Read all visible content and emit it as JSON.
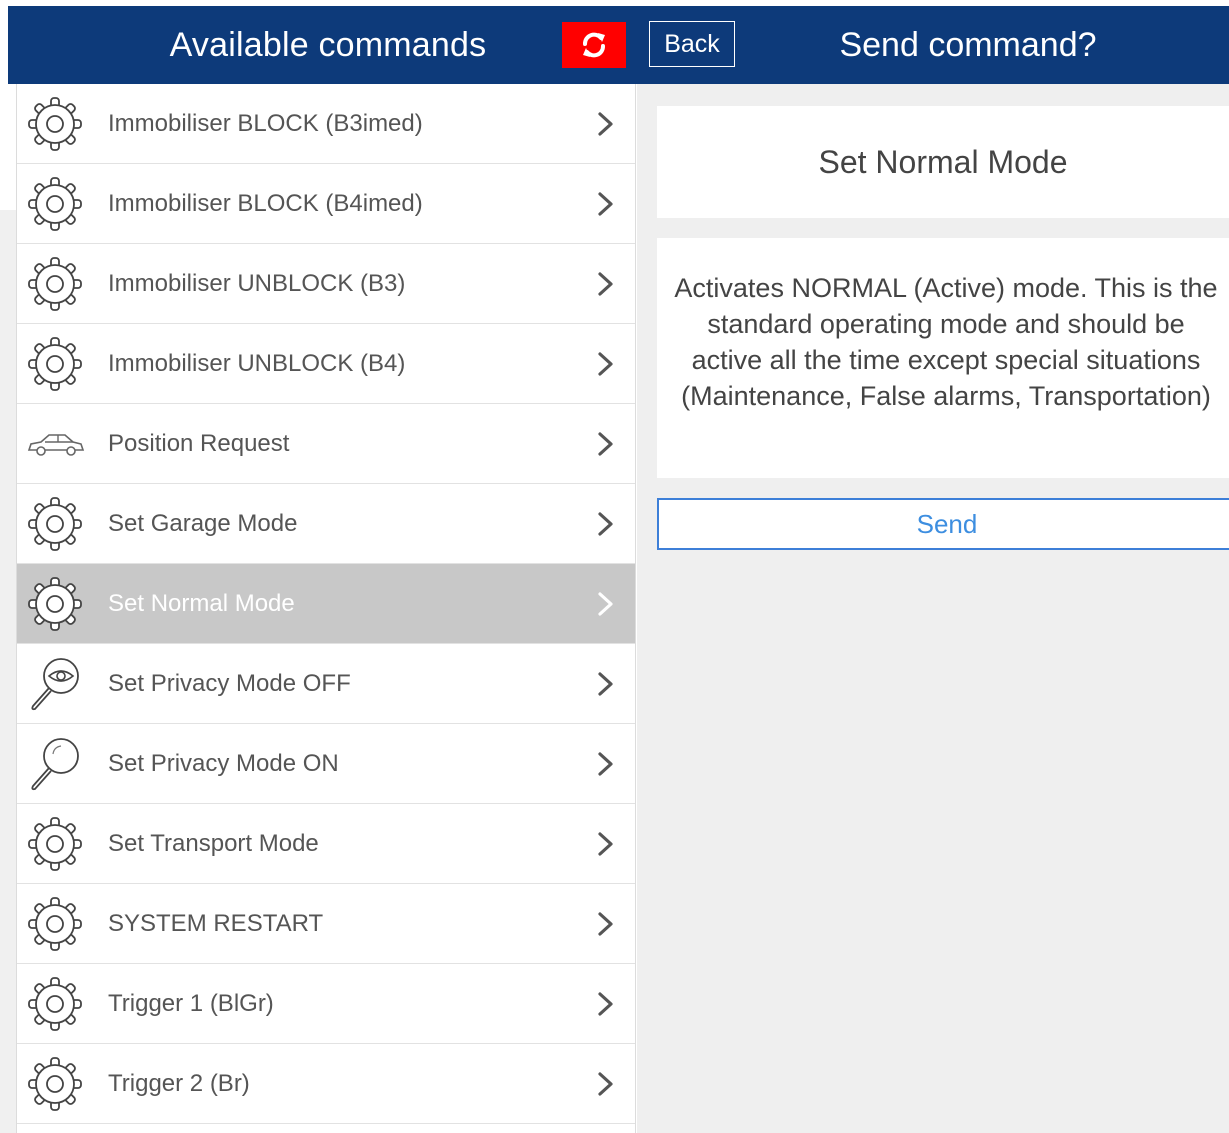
{
  "header": {
    "title_left": "Available commands",
    "back_label": "Back",
    "title_right": "Send command?",
    "refresh_icon": "refresh-icon",
    "colors": {
      "bar": "#0d3a7a",
      "refresh_bg": "#ff0000"
    }
  },
  "commands": [
    {
      "label": "Immobiliser BLOCK (B3imed)",
      "icon": "gear-icon",
      "selected": false
    },
    {
      "label": "Immobiliser BLOCK (B4imed)",
      "icon": "gear-icon",
      "selected": false
    },
    {
      "label": "Immobiliser UNBLOCK (B3)",
      "icon": "gear-icon",
      "selected": false
    },
    {
      "label": "Immobiliser UNBLOCK (B4)",
      "icon": "gear-icon",
      "selected": false
    },
    {
      "label": "Position Request",
      "icon": "car-icon",
      "selected": false
    },
    {
      "label": "Set Garage Mode",
      "icon": "gear-icon",
      "selected": false
    },
    {
      "label": "Set Normal Mode",
      "icon": "gear-icon",
      "selected": true
    },
    {
      "label": "Set Privacy Mode OFF",
      "icon": "eye-magnifier-icon",
      "selected": false
    },
    {
      "label": "Set Privacy Mode ON",
      "icon": "magnifier-icon",
      "selected": false
    },
    {
      "label": "Set Transport Mode",
      "icon": "gear-icon",
      "selected": false
    },
    {
      "label": "SYSTEM RESTART",
      "icon": "gear-icon",
      "selected": false
    },
    {
      "label": "Trigger 1 (BlGr)",
      "icon": "gear-icon",
      "selected": false
    },
    {
      "label": "Trigger 2 (Br)",
      "icon": "gear-icon",
      "selected": false
    }
  ],
  "detail": {
    "title": "Set Normal Mode",
    "description": "Activates NORMAL (Active) mode. This is the standard operating mode and should be active all the time except special situations (Maintenance, False alarms, Transportation)",
    "send_label": "Send",
    "colors": {
      "send_border": "#3d7fd8",
      "send_text": "#3d8ee0"
    }
  }
}
